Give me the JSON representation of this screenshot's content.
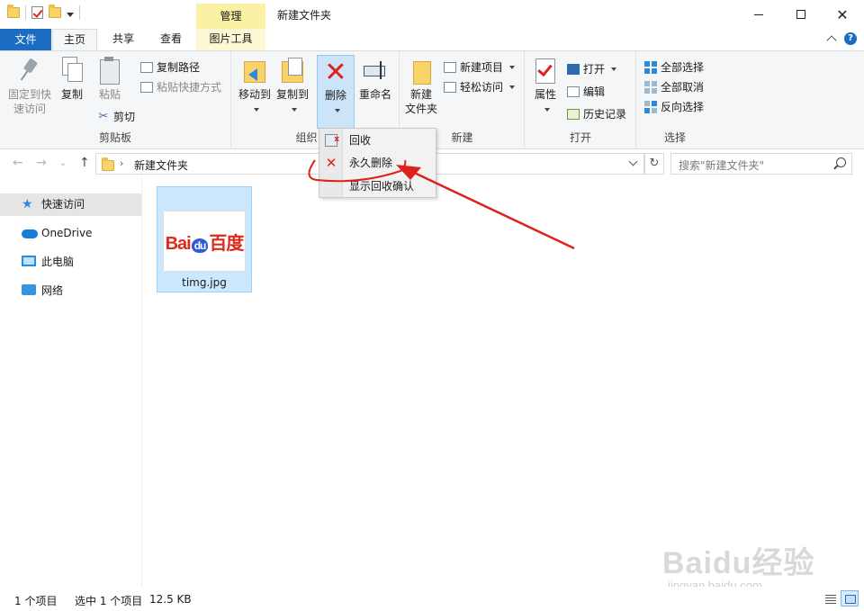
{
  "titlebar": {
    "manage_tab": "管理",
    "title": "新建文件夹",
    "minimize": "minimize-icon",
    "maximize": "maximize-icon",
    "close": "✕"
  },
  "tabs": {
    "file": "文件",
    "home": "主页",
    "share": "共享",
    "view": "查看",
    "picture_tools": "图片工具"
  },
  "ribbon": {
    "clipboard": {
      "label": "剪贴板",
      "pin_line1": "固定到快",
      "pin_line2": "速访问",
      "copy": "复制",
      "paste": "粘贴",
      "copy_path": "复制路径",
      "paste_shortcut": "粘贴快捷方式",
      "cut": "剪切"
    },
    "organize": {
      "label": "组织",
      "move_to": "移动到",
      "copy_to": "复制到",
      "delete": "删除",
      "rename": "重命名"
    },
    "new": {
      "label": "新建",
      "new_folder_line1": "新建",
      "new_folder_line2": "文件夹",
      "new_item": "新建项目",
      "easy_access": "轻松访问"
    },
    "open": {
      "label": "打开",
      "properties": "属性",
      "open": "打开",
      "edit": "编辑",
      "history": "历史记录"
    },
    "select": {
      "label": "选择",
      "select_all": "全部选择",
      "select_none": "全部取消",
      "invert": "反向选择"
    }
  },
  "delete_menu": {
    "recycle": "回收",
    "permanent": "永久删除",
    "confirm": "显示回收确认"
  },
  "address": {
    "path": "新建文件夹",
    "search_placeholder": "搜索\"新建文件夹\""
  },
  "sidebar": {
    "items": [
      {
        "label": "快速访问",
        "icon": "star-icon"
      },
      {
        "label": "OneDrive",
        "icon": "cloud-icon"
      },
      {
        "label": "此电脑",
        "icon": "computer-icon"
      },
      {
        "label": "网络",
        "icon": "network-icon"
      }
    ]
  },
  "files": [
    {
      "name": "timg.jpg",
      "thumb_text_a": "Bai",
      "thumb_text_b": "du",
      "thumb_text_c": "百度"
    }
  ],
  "status": {
    "count": "1 个项目",
    "selected": "选中 1 个项目",
    "size": "12.5 KB"
  },
  "watermark": {
    "main": "Baidu经验",
    "sub": "jingyan.baidu.com"
  },
  "colors": {
    "accent": "#1c6dc2",
    "annotation": "#e0201a",
    "manage_tab": "#fbf1a4"
  }
}
